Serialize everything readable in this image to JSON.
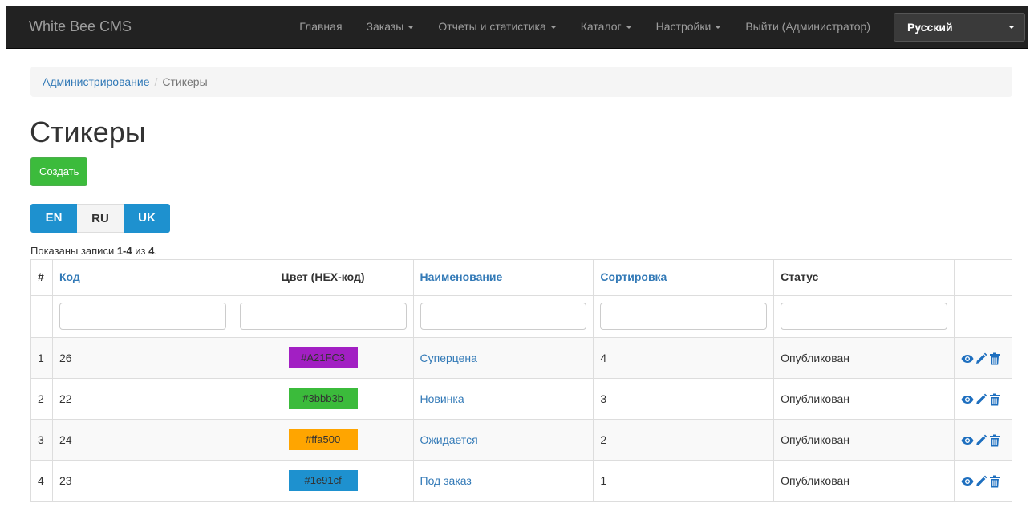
{
  "navbar": {
    "brand": "White Bee CMS",
    "items": [
      {
        "label": "Главная",
        "dropdown": false
      },
      {
        "label": "Заказы",
        "dropdown": true
      },
      {
        "label": "Отчеты и статистика",
        "dropdown": true
      },
      {
        "label": "Каталог",
        "dropdown": true
      },
      {
        "label": "Настройки",
        "dropdown": true
      },
      {
        "label": "Выйти (Администратор)",
        "dropdown": false
      }
    ],
    "language": "Русский"
  },
  "breadcrumb": {
    "root": "Администрирование",
    "separator": "/",
    "current": "Стикеры"
  },
  "page": {
    "title": "Стикеры",
    "create_label": "Создать"
  },
  "lang_tabs": [
    "EN",
    "RU",
    "UK"
  ],
  "summary": {
    "prefix": "Показаны записи ",
    "range": "1-4",
    "middle": " из ",
    "total": "4",
    "suffix": "."
  },
  "table": {
    "columns": [
      "#",
      "Код",
      "Цвет (HEX-код)",
      "Наименование",
      "Сортировка",
      "Статус"
    ],
    "rows": [
      {
        "num": "1",
        "code": "26",
        "color": "#A21FC3",
        "color_label": "#A21FC3",
        "name": "Суперцена",
        "sort": "4",
        "status": "Опубликован"
      },
      {
        "num": "2",
        "code": "22",
        "color": "#3bbb3b",
        "color_label": "#3bbb3b",
        "name": "Новинка",
        "sort": "3",
        "status": "Опубликован"
      },
      {
        "num": "3",
        "code": "24",
        "color": "#ffa500",
        "color_label": "#ffa500",
        "name": "Ожидается",
        "sort": "2",
        "status": "Опубликован"
      },
      {
        "num": "4",
        "code": "23",
        "color": "#1e91cf",
        "color_label": "#1e91cf",
        "name": "Под заказ",
        "sort": "1",
        "status": "Опубликован"
      }
    ]
  },
  "icons": {
    "view": "eye-icon",
    "edit": "pencil-icon",
    "delete": "trash-icon"
  },
  "colors": {
    "accent": "#337ab7",
    "icon_blue": "#1e6fbf",
    "create_green": "#3cbb3c",
    "lang_blue": "#1e91cf",
    "navbar": "#222222"
  }
}
